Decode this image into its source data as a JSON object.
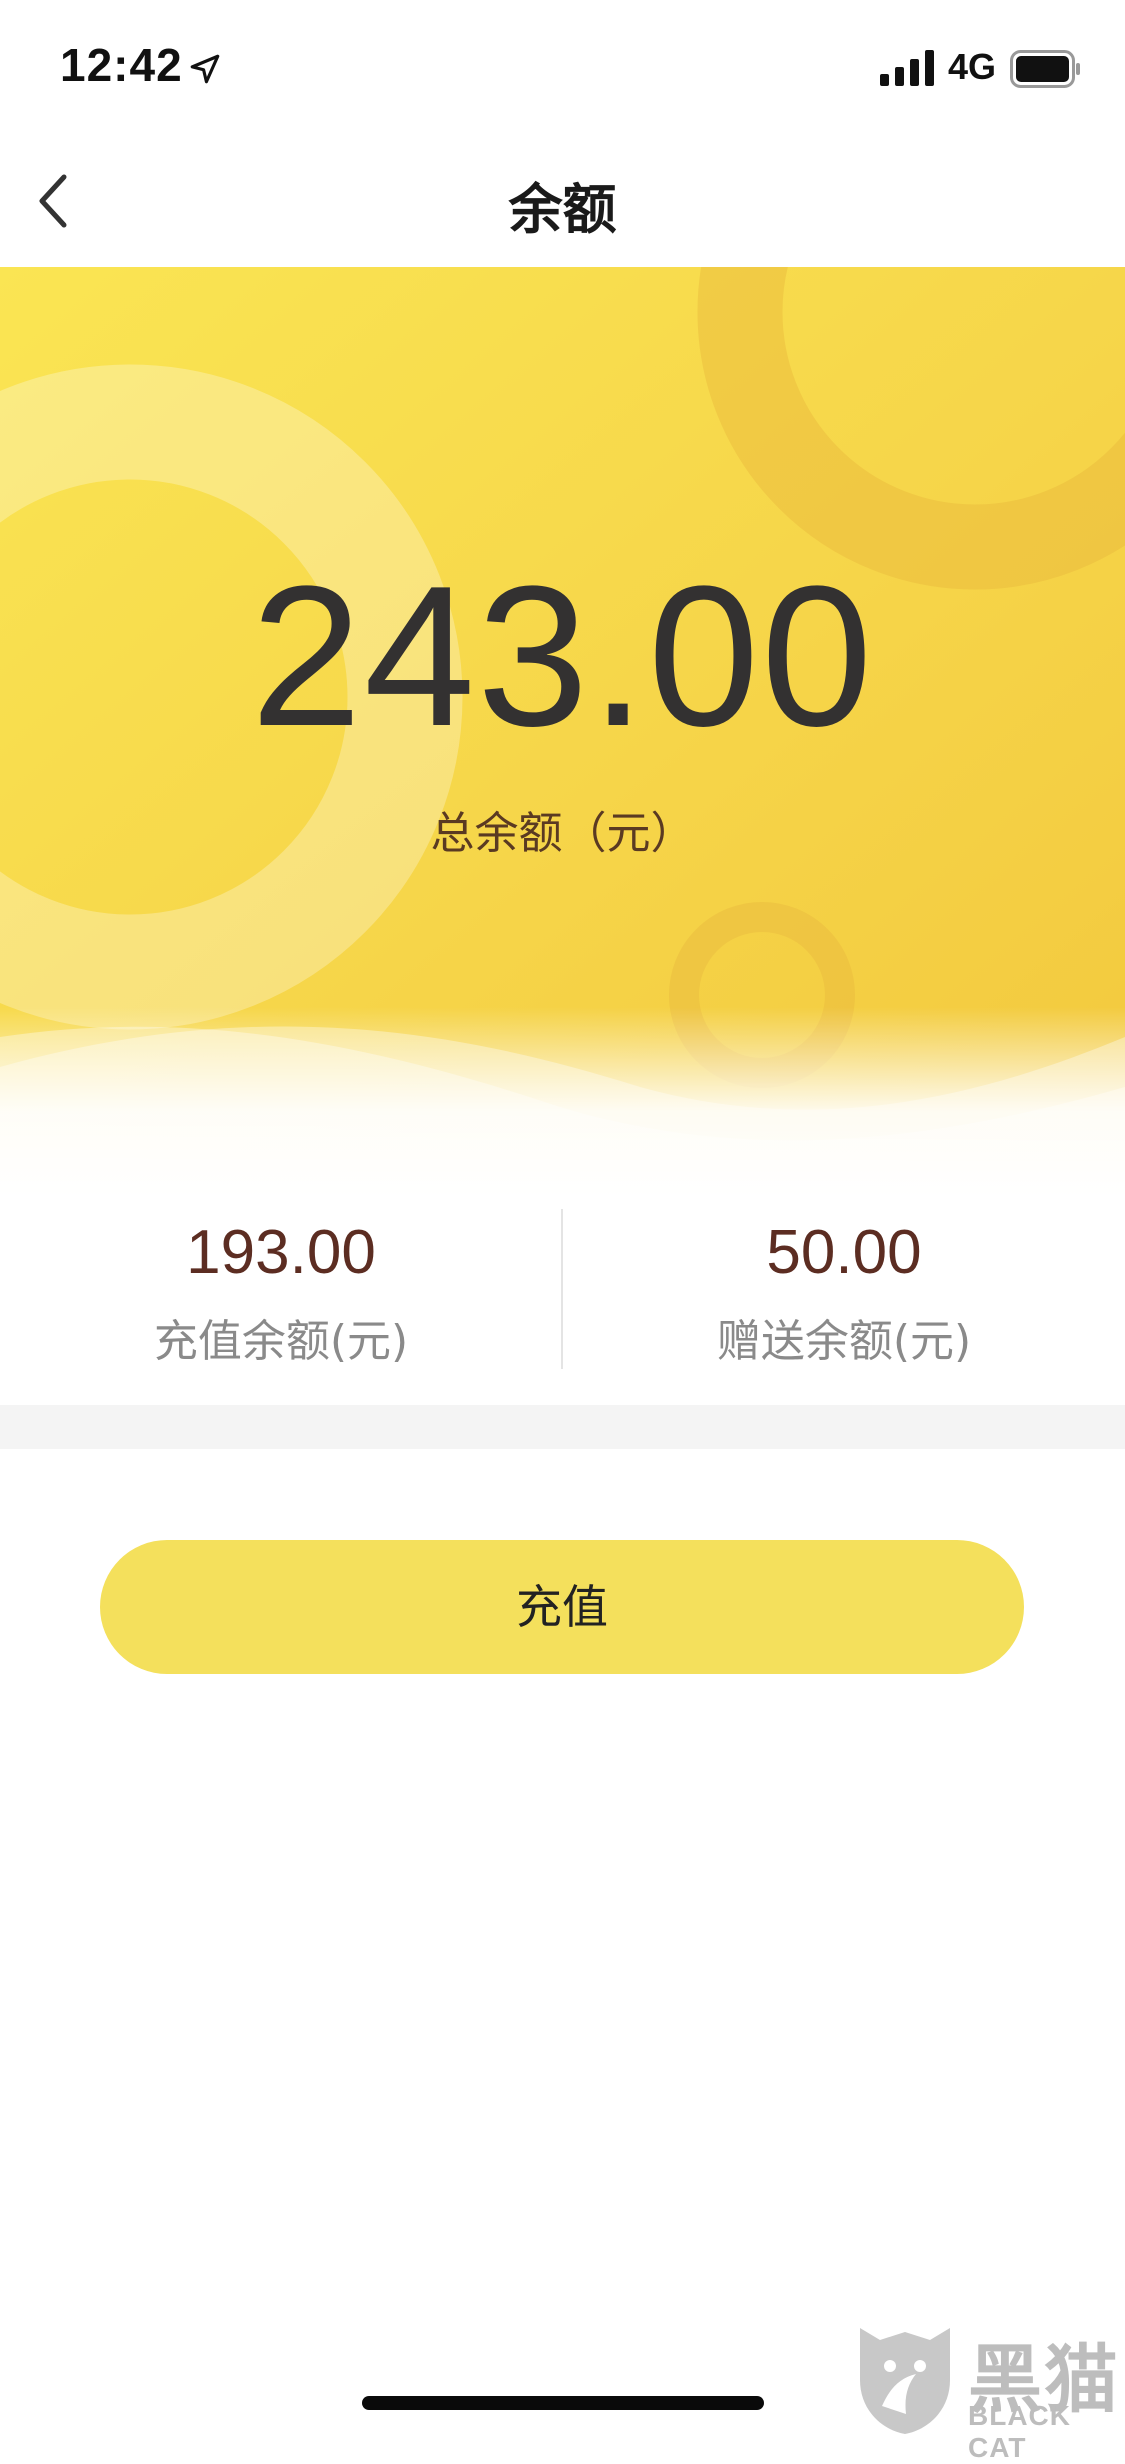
{
  "status_bar": {
    "time": "12:42",
    "network": "4G",
    "icons": [
      "location-arrow-icon",
      "signal-bars-icon",
      "battery-icon"
    ]
  },
  "nav": {
    "title": "余额",
    "back_icon": "chevron-left-icon"
  },
  "balance": {
    "total_value": "243.00",
    "total_label": "总余额（元）",
    "recharge_value": "193.00",
    "recharge_label": "充值余额(元)",
    "bonus_value": "50.00",
    "bonus_label": "赠送余额(元)"
  },
  "actions": {
    "recharge_button": "充值"
  },
  "watermark": {
    "brand_cn": "黑猫",
    "brand_en": "BLACK CAT",
    "logo_icon": "black-cat-logo"
  },
  "colors": {
    "hero_yellow": "#f7d64a",
    "button_yellow": "#f4e05c",
    "value_brown": "#5c2d22",
    "total_value_color": "#333131"
  }
}
